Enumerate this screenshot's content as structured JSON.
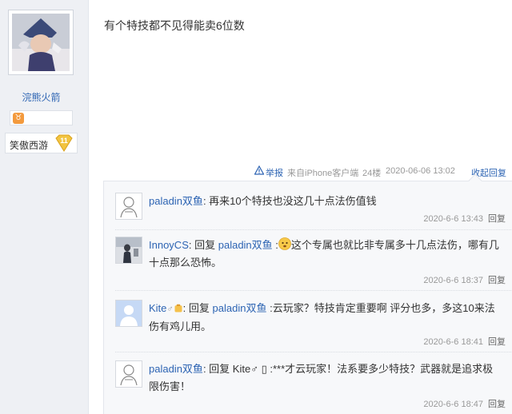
{
  "user": {
    "name": "浣熊火箭",
    "level_title": "笑傲西游",
    "level_num": "11"
  },
  "post": {
    "content": "有个特技都不见得能卖6位数",
    "report": "举报",
    "client": "来自iPhone客户端",
    "floor": "24楼",
    "time": "2020-06-06 13:02",
    "collapse": "收起回复"
  },
  "replies": [
    {
      "name": "paladin双鱼",
      "sep": ":",
      "text": " 再来10个特技也没这几十点法伤值钱",
      "time": "2020-6-6 13:43",
      "reply_label": "回复"
    },
    {
      "name": "InnoyCS",
      "sep": ":",
      "reply_word": " 回复 ",
      "target": "paladin双鱼",
      "target_sep": " :",
      "text": "这个专属也就比非专属多十几点法伤，哪有几十点那么恐怖。",
      "time": "2020-6-6 18:37",
      "reply_label": "回复"
    },
    {
      "name": "Kite",
      "sex": "♂",
      "sep": ":",
      "reply_word": " 回复 ",
      "target": "paladin双鱼",
      "target_sep": " :",
      "text": "云玩家？特技肯定重要啊 评分也多，多这10来法伤有鸡儿用。",
      "time": "2020-6-6 18:41",
      "reply_label": "回复"
    },
    {
      "name": "paladin双鱼",
      "sep": ":",
      "reply_word": " 回复 ",
      "target": "Kite",
      "target_extra": "♂ ▯ ",
      "text": ":***才云玩家！法系要多少特技？武器就是追求极限伤害！",
      "time": "2020-6-6 18:47",
      "reply_label": "回复"
    }
  ]
}
